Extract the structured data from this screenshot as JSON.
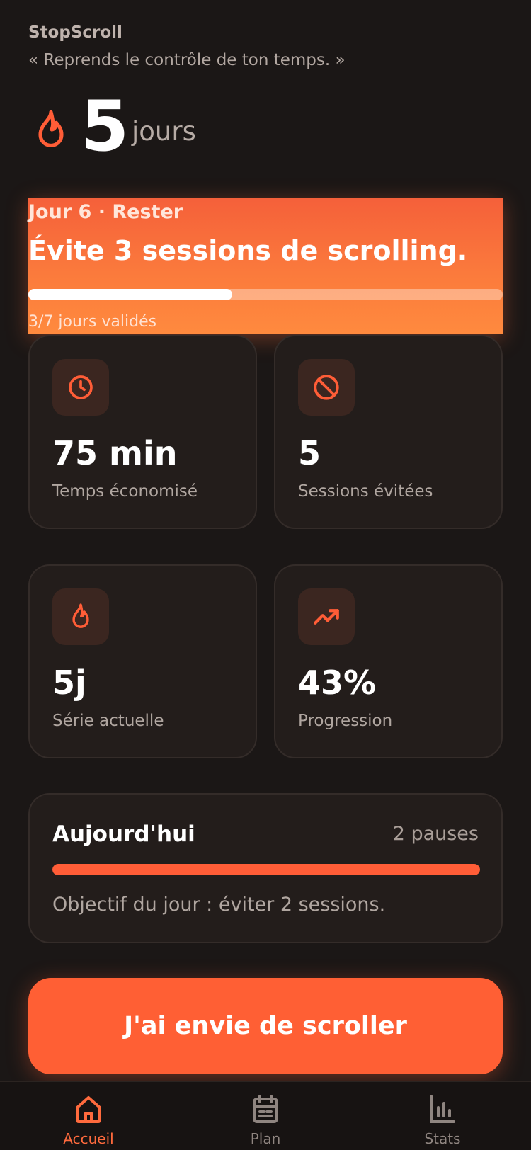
{
  "header": {
    "app_name": "StopScroll",
    "tagline": "« Reprends le contrôle de ton temps. »"
  },
  "streak": {
    "icon": "flame-icon",
    "value": "5",
    "unit": "jours"
  },
  "challenge": {
    "day_label": "Jour 6 · Rester",
    "title": "Évite 3 sessions de scrolling.",
    "progress_fraction": 0.43,
    "caption": "3/7 jours validés"
  },
  "stats": [
    {
      "icon": "clock-icon",
      "value": "75 min",
      "label": "Temps économisé"
    },
    {
      "icon": "block-icon",
      "value": "5",
      "label": "Sessions évitées"
    },
    {
      "icon": "flame-icon",
      "value": "5j",
      "label": "Série actuelle"
    },
    {
      "icon": "trending-up-icon",
      "value": "43%",
      "label": "Progression"
    }
  ],
  "today": {
    "title": "Aujourd'hui",
    "count": "2 pauses",
    "progress_fraction": 1.0,
    "note": "Objectif du jour : éviter 2 sessions."
  },
  "cta": {
    "label": "J'ai envie de scroller"
  },
  "tabs": [
    {
      "icon": "home-icon",
      "label": "Accueil",
      "active": true
    },
    {
      "icon": "calendar-icon",
      "label": "Plan",
      "active": false
    },
    {
      "icon": "bar-chart-icon",
      "label": "Stats",
      "active": false
    }
  ],
  "colors": {
    "accent": "#ff5f34",
    "background": "#1b1716",
    "card": "#231d1b"
  }
}
